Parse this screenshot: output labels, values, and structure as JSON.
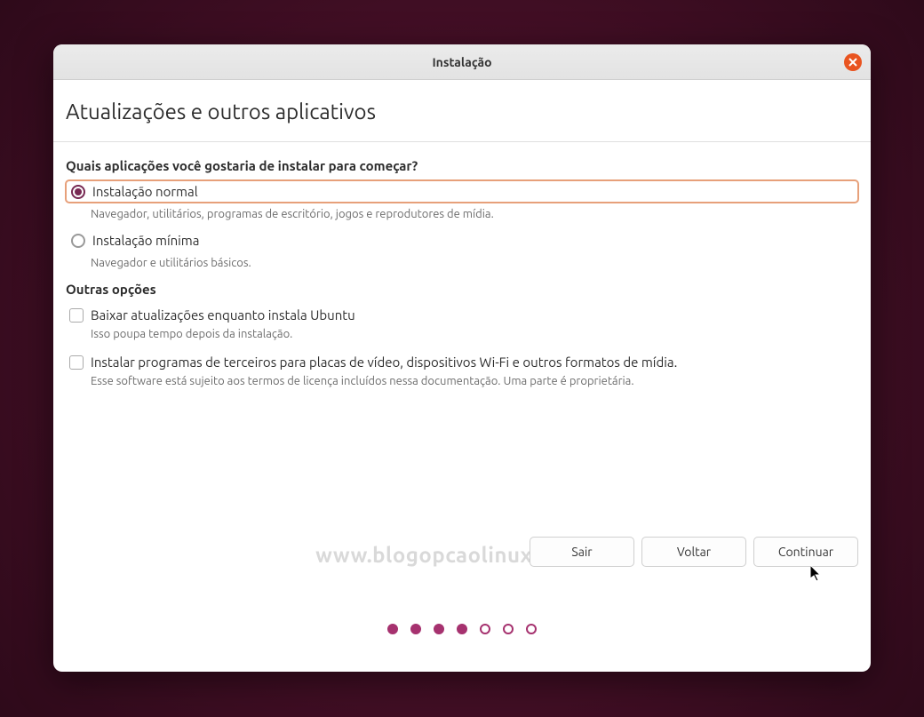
{
  "window": {
    "title": "Instalação"
  },
  "page": {
    "title": "Atualizações e outros aplicativos",
    "question": "Quais aplicações você gostaria de instalar para começar?"
  },
  "options": {
    "normal": {
      "label": "Instalação normal",
      "desc": "Navegador, utilitários, programas de escritório, jogos e reprodutores de mídia."
    },
    "minimal": {
      "label": "Instalação mínima",
      "desc": "Navegador e utilitários básicos."
    }
  },
  "other": {
    "heading": "Outras opções",
    "download": {
      "label": "Baixar atualizações enquanto instala Ubuntu",
      "desc": "Isso poupa tempo depois da instalação."
    },
    "thirdparty": {
      "label": "Instalar programas de terceiros para placas de vídeo, dispositivos Wi-Fi e outros formatos de mídia.",
      "desc": "Esse software está sujeito aos termos de licença incluídos nessa documentação. Uma parte é proprietária."
    }
  },
  "buttons": {
    "quit": "Sair",
    "back": "Voltar",
    "continue": "Continuar"
  },
  "watermark": "www.blogopcaolinux.com.br",
  "progress": {
    "total": 7,
    "current": 4
  }
}
